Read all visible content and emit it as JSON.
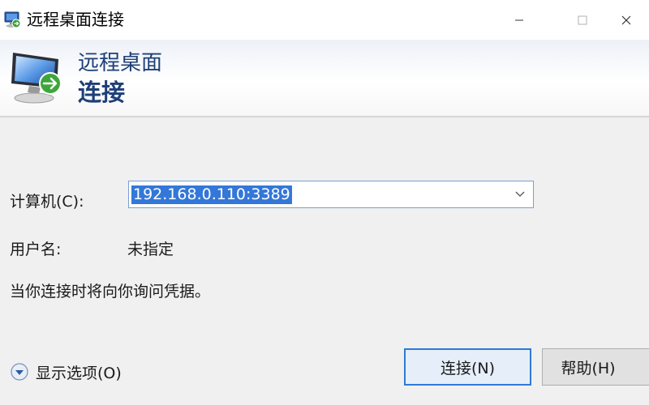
{
  "window": {
    "title": "远程桌面连接",
    "controls": {
      "minimize_icon": "minimize-icon",
      "maximize_icon": "maximize-icon",
      "close_icon": "close-icon"
    }
  },
  "banner": {
    "line1": "远程桌面",
    "line2": "连接",
    "title_color": "#1e3f78",
    "icon": "remote-desktop-monitor-icon"
  },
  "form": {
    "computer_label": "计算机(C):",
    "computer_value": "192.168.0.110:3389",
    "computer_dropdown_icon": "chevron-down-icon",
    "user_label": "用户名:",
    "user_value": "未指定",
    "hint": "当你连接时将向你询问凭据。"
  },
  "footer": {
    "options_label": "显示选项(O)",
    "options_icon": "expand-down-circle-icon",
    "connect_button": "连接(N)",
    "help_button": "帮助(H)"
  },
  "colors": {
    "selection": "#3377d8",
    "focus_border": "#2f7ad6",
    "dialog_background": "#f0f0f0"
  }
}
